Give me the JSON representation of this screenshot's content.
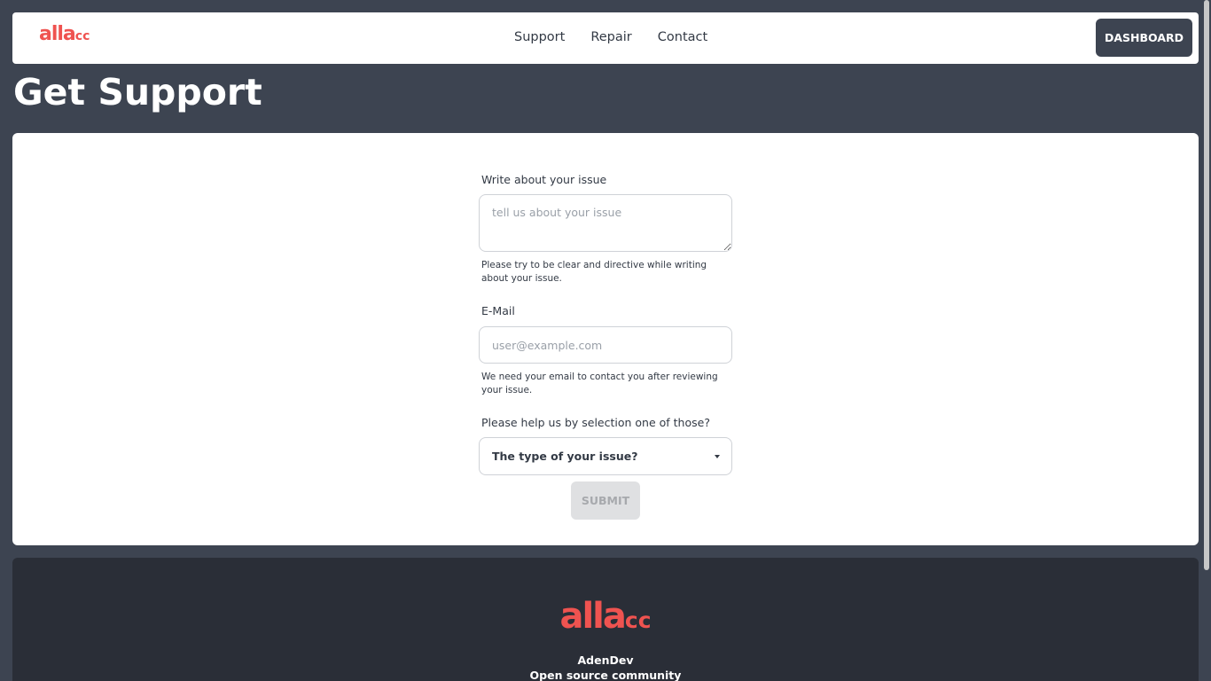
{
  "navbar": {
    "logo_main": "alla",
    "logo_suffix": "cc",
    "links": [
      "Support",
      "Repair",
      "Contact"
    ],
    "dashboard_label": "DASHBOARD"
  },
  "page": {
    "title": "Get Support"
  },
  "form": {
    "issue_label": "Write about your issue",
    "issue_placeholder": "tell us about your issue",
    "issue_helper": "Please try to be clear and directive while writing about your issue.",
    "email_label": "E-Mail",
    "email_placeholder": "user@example.com",
    "email_helper": "We need your email to contact you after reviewing your issue.",
    "type_label": "Please help us by selection one of those?",
    "type_selected": "The type of your issue?",
    "submit_label": "SUBMIT"
  },
  "footer": {
    "logo_main": "alla",
    "logo_suffix": "cc",
    "name": "AdenDev",
    "tagline": "Open source community"
  },
  "colors": {
    "background": "#3d4451",
    "accent_logo": "#ef5350",
    "footer_bg": "#2a2e37"
  }
}
